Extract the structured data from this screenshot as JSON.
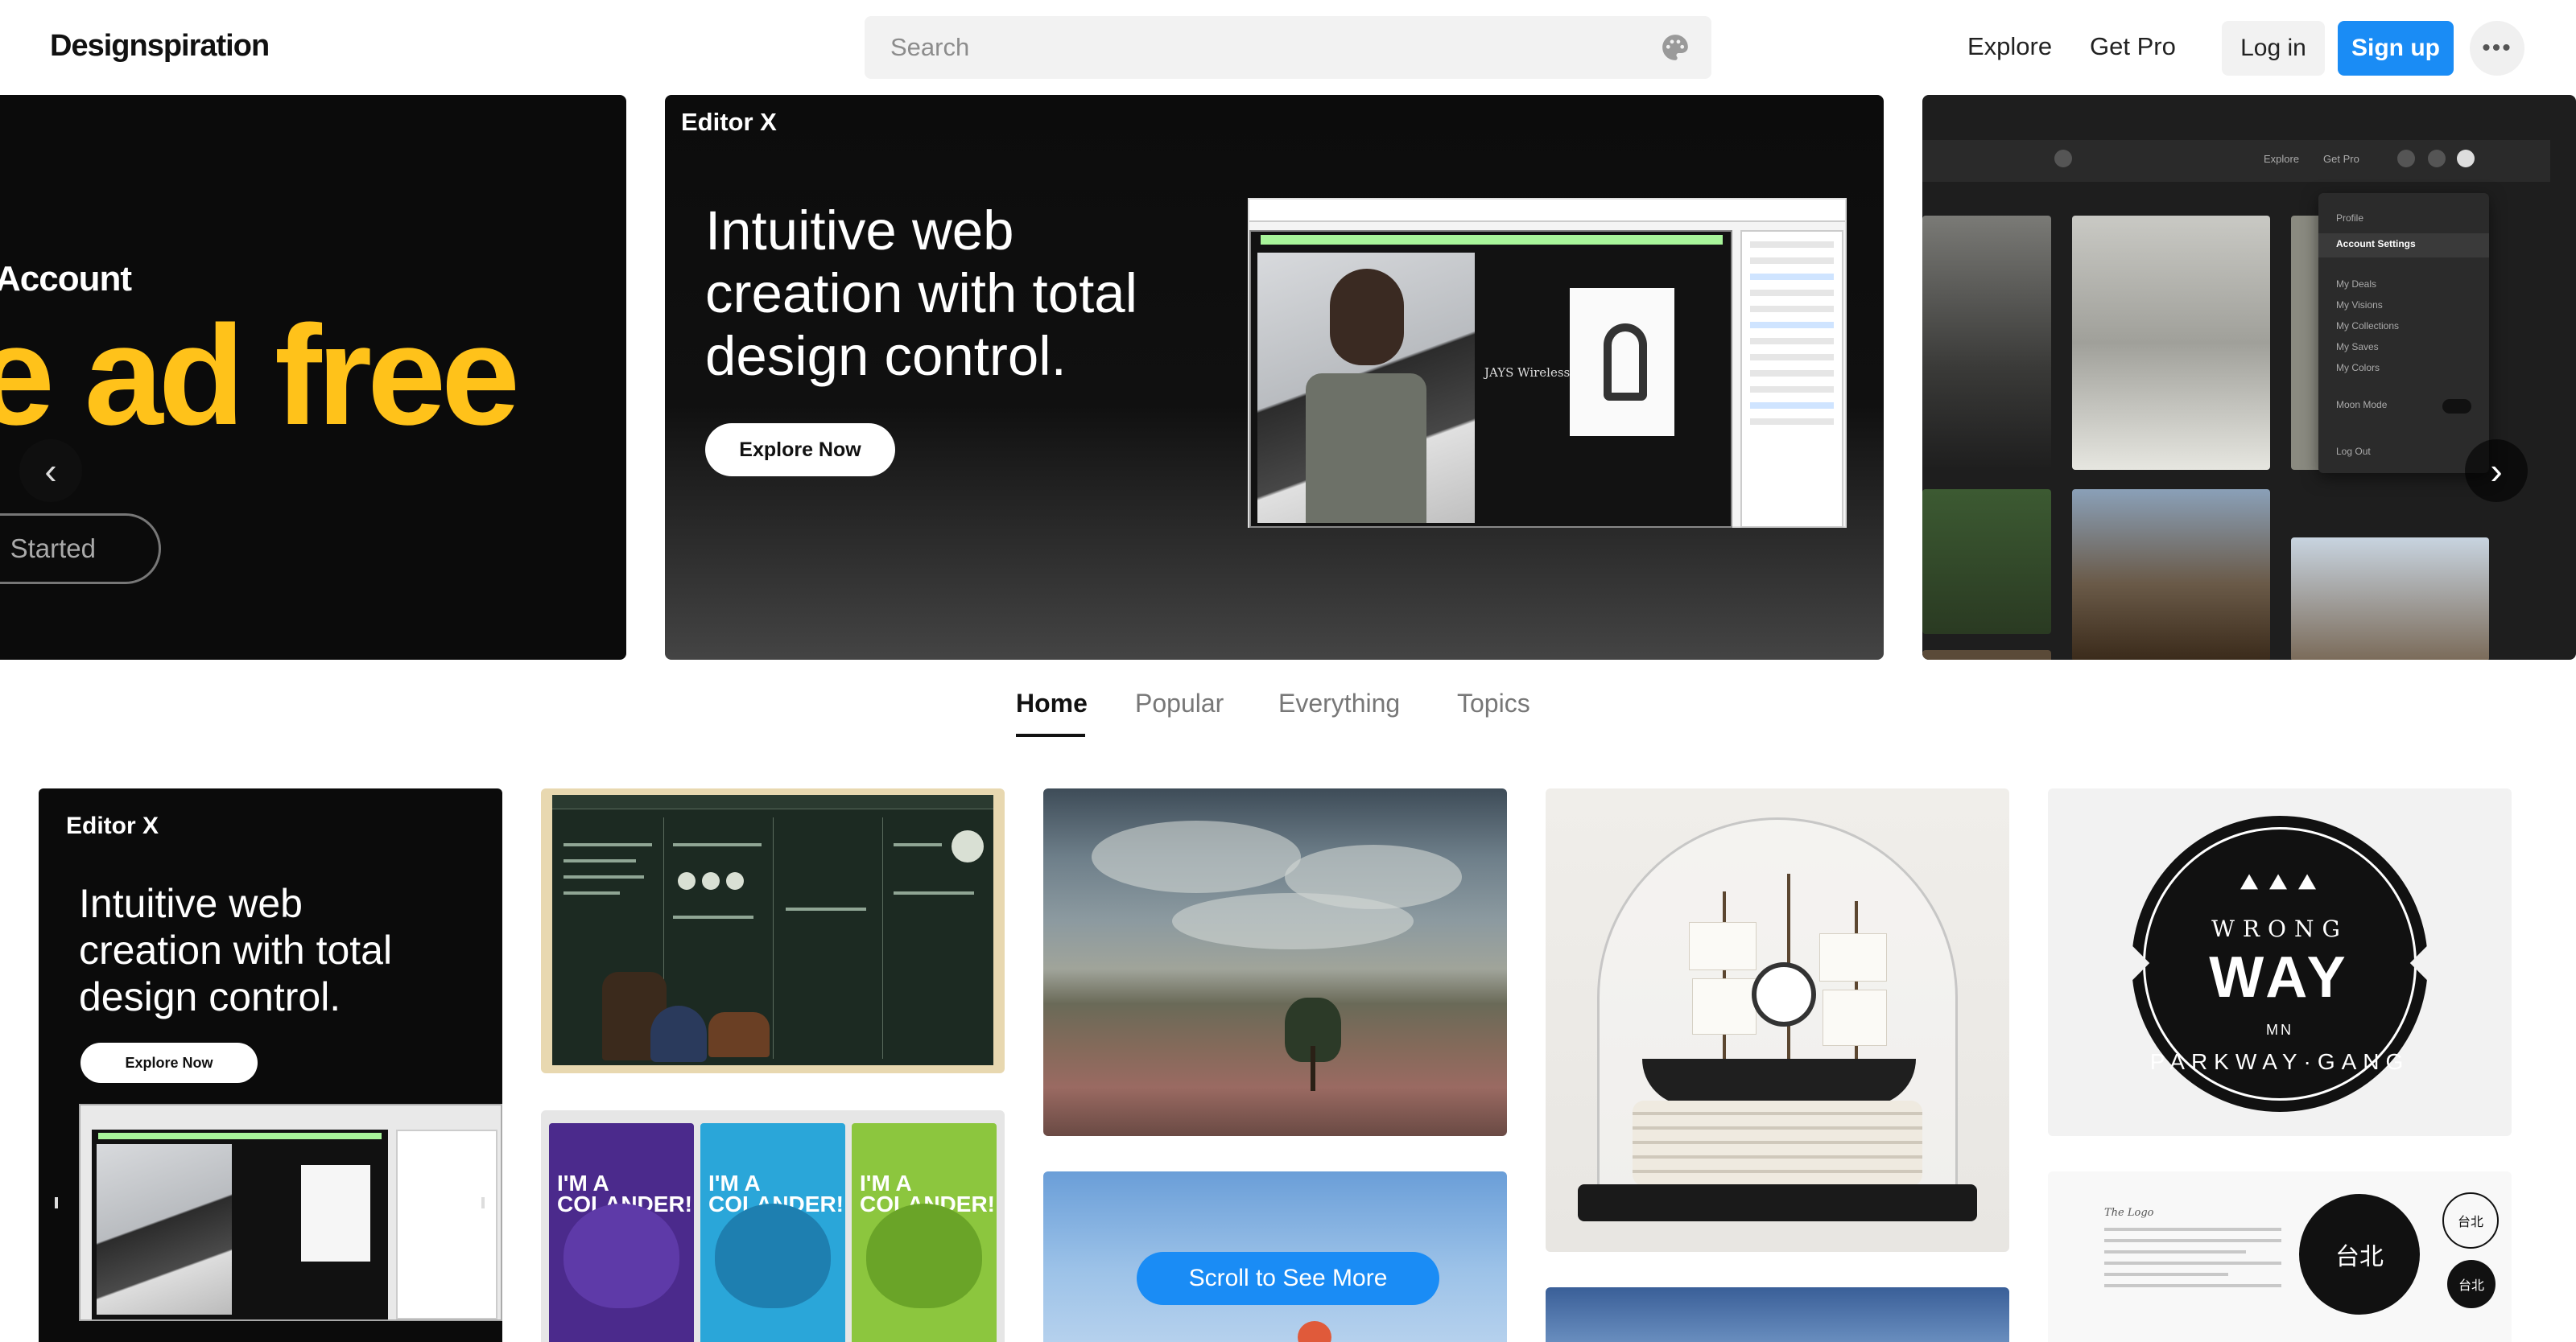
{
  "header": {
    "logo": "Designspiration",
    "search_placeholder": "Search",
    "nav": {
      "explore": "Explore",
      "get_pro": "Get Pro"
    },
    "login": "Log in",
    "signup": "Sign up",
    "more": "•••"
  },
  "hero": {
    "left_slide": {
      "eyebrow": "Account",
      "big_text": "e ad free",
      "button": "Started"
    },
    "center_slide": {
      "brand": "Editor X",
      "headline": "Intuitive web creation with total design control.",
      "cta": "Explore Now",
      "mock_product_title": "JAYS Wireless"
    },
    "right_slide": {
      "nav_explore": "Explore",
      "nav_get_pro": "Get Pro",
      "menu": {
        "profile": "Profile",
        "account_settings": "Account Settings",
        "my_deals": "My Deals",
        "my_visions": "My Visions",
        "my_collections": "My Collections",
        "my_saves": "My Saves",
        "my_colors": "My Colors",
        "moon_mode": "Moon Mode",
        "log_out": "Log Out"
      }
    },
    "prev_icon": "‹",
    "next_icon": "›"
  },
  "tabs": [
    {
      "label": "Home",
      "active": true
    },
    {
      "label": "Popular",
      "active": false
    },
    {
      "label": "Everything",
      "active": false
    },
    {
      "label": "Topics",
      "active": false
    }
  ],
  "grid": {
    "editorx_card": {
      "brand": "Editor X",
      "headline": "Intuitive web creation with total design control.",
      "cta": "Explore Now"
    },
    "colander_label": "I'M A COLANDER!",
    "badge": {
      "trees": "⯅⯅⯅",
      "top": "WRONG",
      "main": "WAY",
      "mid": "MN",
      "bottom": "PARKWAY·GANG"
    },
    "doc_card": {
      "title": "The Logo",
      "seal_main": "台北",
      "seal_small_1": "台北",
      "seal_small_2": "台北"
    }
  },
  "scroll_button": "Scroll to See More",
  "colors": {
    "accent": "#1a8cf5",
    "hero_yellow": "#ffc21a",
    "mock_green": "#a8f59a",
    "colander_purple": "#4b2a8c",
    "colander_blue": "#2aa6d9",
    "colander_green": "#8cc63e"
  },
  "icons": {
    "search": "palette-icon",
    "prev": "chevron-left-icon",
    "next": "chevron-right-icon"
  }
}
